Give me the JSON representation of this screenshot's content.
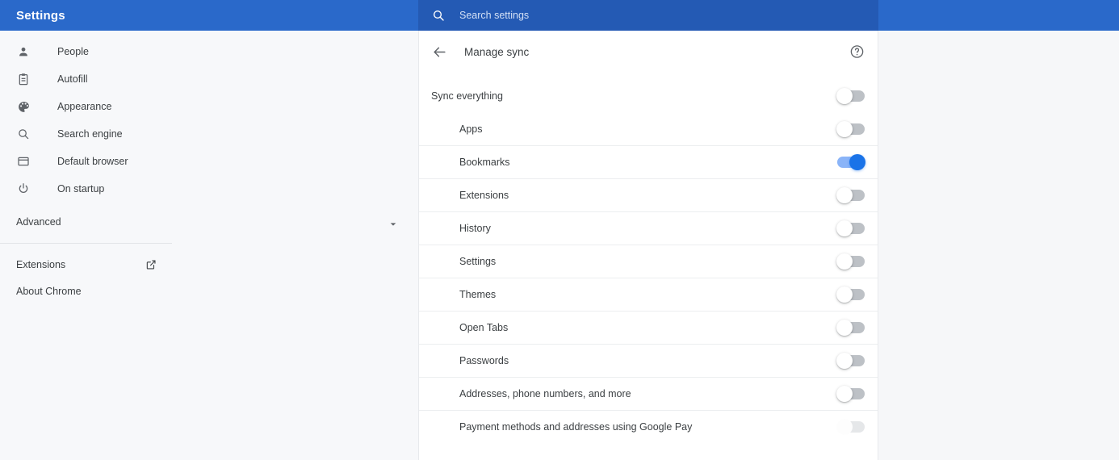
{
  "header": {
    "title": "Settings",
    "search_icon": "search-icon",
    "search_placeholder": "Search settings",
    "search_value": ""
  },
  "colors": {
    "header_blue": "#2a69ca",
    "search_blue": "#245ab4",
    "toggle_on_track": "#8ab4f8",
    "toggle_on_knob": "#1a73e8",
    "toggle_off_track": "#bdc1c6",
    "card_background": "#ffffff",
    "page_background": "#f6f7f9"
  },
  "sidebar": {
    "items": [
      {
        "label": "People",
        "icon": "person-icon"
      },
      {
        "label": "Autofill",
        "icon": "clipboard-icon"
      },
      {
        "label": "Appearance",
        "icon": "palette-icon"
      },
      {
        "label": "Search engine",
        "icon": "magnifier-icon"
      },
      {
        "label": "Default browser",
        "icon": "browser-window-icon"
      },
      {
        "label": "On startup",
        "icon": "power-icon"
      }
    ],
    "advanced": {
      "label": "Advanced",
      "icon": "chevron-down-icon"
    },
    "footer": [
      {
        "label": "Extensions",
        "icon": "external-link-icon"
      },
      {
        "label": "About Chrome",
        "icon": ""
      }
    ]
  },
  "main": {
    "back_icon": "arrow-left-icon",
    "title": "Manage sync",
    "help_icon": "help-circle-icon",
    "rows": [
      {
        "label": "Sync everything",
        "state": "off",
        "level": "top"
      },
      {
        "label": "Apps",
        "state": "off",
        "level": "sub"
      },
      {
        "label": "Bookmarks",
        "state": "on",
        "level": "sub"
      },
      {
        "label": "Extensions",
        "state": "off",
        "level": "sub"
      },
      {
        "label": "History",
        "state": "off",
        "level": "sub"
      },
      {
        "label": "Settings",
        "state": "off",
        "level": "sub"
      },
      {
        "label": "Themes",
        "state": "off",
        "level": "sub"
      },
      {
        "label": "Open Tabs",
        "state": "off",
        "level": "sub"
      },
      {
        "label": "Passwords",
        "state": "off",
        "level": "sub"
      },
      {
        "label": "Addresses, phone numbers, and more",
        "state": "off",
        "level": "sub"
      },
      {
        "label": "Payment methods and addresses using Google Pay",
        "state": "disabled",
        "level": "sub"
      }
    ]
  }
}
